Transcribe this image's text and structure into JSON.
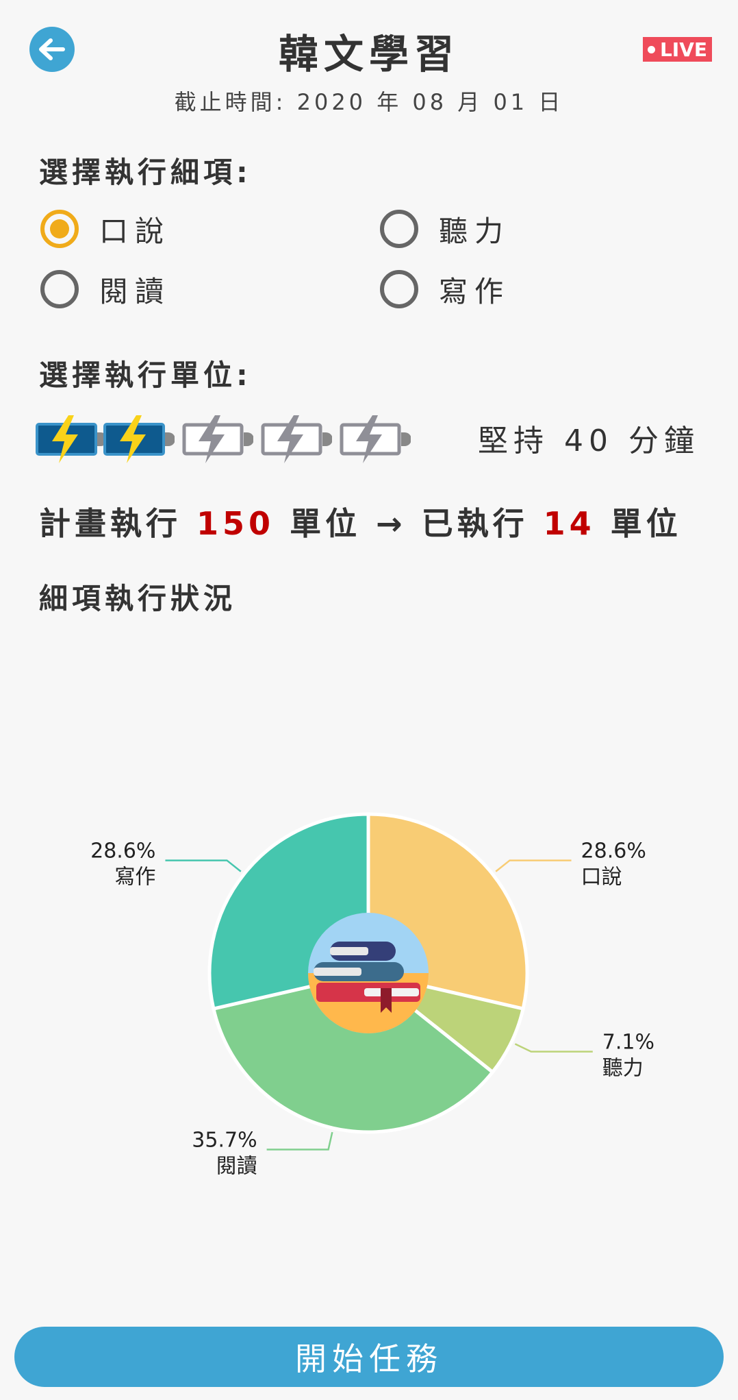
{
  "header": {
    "title": "韓文學習",
    "live_badge": "LIVE",
    "deadline": "截止時間: 2020 年 08 月 01 日"
  },
  "detail_section": {
    "title": "選擇執行細項:",
    "options": [
      {
        "label": "口說",
        "selected": true
      },
      {
        "label": "聽力",
        "selected": false
      },
      {
        "label": "閱讀",
        "selected": false
      },
      {
        "label": "寫作",
        "selected": false
      }
    ]
  },
  "unit_section": {
    "title": "選擇執行單位:",
    "units_selected": 2,
    "units_total": 5,
    "persist_text": "堅持 40 分鐘"
  },
  "plan": {
    "prefix": "計畫執行",
    "planned": "150",
    "unit1": "單位",
    "arrow": "→",
    "done_prefix": "已執行",
    "executed": "14",
    "unit2": "單位"
  },
  "status_title": "細項執行狀況",
  "chart_data": {
    "type": "pie",
    "style": "donut with center book illustration",
    "slices": [
      {
        "label": "口說",
        "value": 28.6,
        "display": "28.6%",
        "color": "#f8cc74"
      },
      {
        "label": "聽力",
        "value": 7.1,
        "display": "7.1%",
        "color": "#bcd379"
      },
      {
        "label": "閱讀",
        "value": 35.7,
        "display": "35.7%",
        "color": "#80cf8e"
      },
      {
        "label": "寫作",
        "value": 28.6,
        "display": "28.6%",
        "color": "#46c6ae"
      }
    ]
  },
  "start_button": "開始任務",
  "colors": {
    "accent": "#3fa5d3",
    "radio_selected": "#f0ab1a",
    "live_badge": "#ef4b5a",
    "highlight_number": "#c00000"
  }
}
